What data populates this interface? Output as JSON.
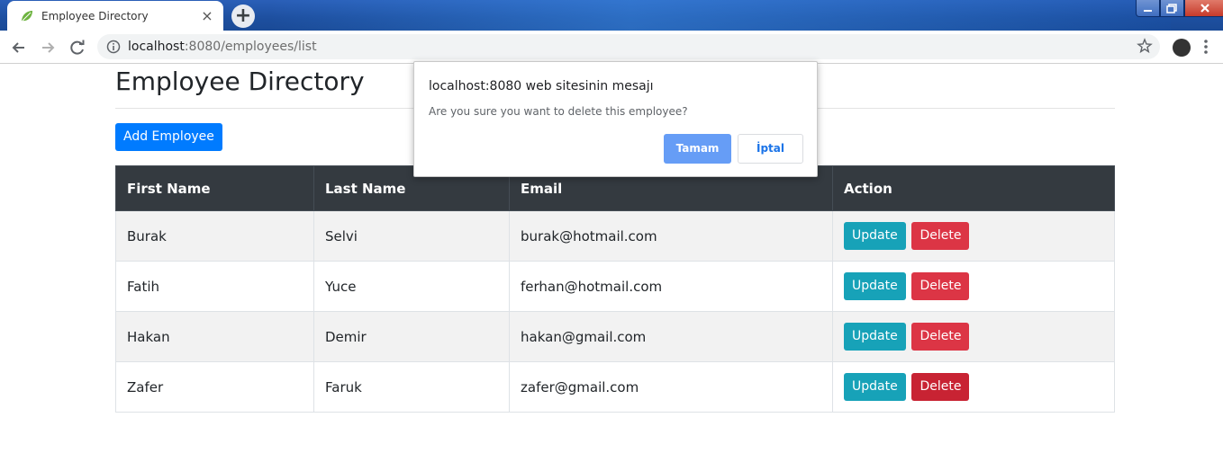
{
  "browser": {
    "tab": {
      "title": "Employee Directory",
      "close_glyph": "×",
      "favicon": "spring-leaf-icon"
    },
    "new_tab_glyph": "+",
    "address": {
      "host": "localhost",
      "rest": ":8080/employees/list"
    }
  },
  "page": {
    "title": "Employee Directory",
    "add_button": "Add Employee",
    "table": {
      "headers": [
        "First Name",
        "Last Name",
        "Email",
        "Action"
      ],
      "rows": [
        {
          "first": "Burak",
          "last": "Selvi",
          "email": "burak@hotmail.com",
          "update": "Update",
          "delete": "Delete"
        },
        {
          "first": "Fatih",
          "last": "Yuce",
          "email": "ferhan@hotmail.com",
          "update": "Update",
          "delete": "Delete"
        },
        {
          "first": "Hakan",
          "last": "Demir",
          "email": "hakan@gmail.com",
          "update": "Update",
          "delete": "Delete"
        },
        {
          "first": "Zafer",
          "last": "Faruk",
          "email": "zafer@gmail.com",
          "update": "Update",
          "delete": "Delete"
        }
      ]
    }
  },
  "dialog": {
    "title": "localhost:8080 web sitesinin mesajı",
    "message": "Are you sure you want to delete this employee?",
    "ok": "Tamam",
    "cancel": "İptal"
  },
  "colors": {
    "primary": "#007bff",
    "info": "#17a2b8",
    "danger": "#dc3545",
    "table_header": "#343a40"
  }
}
